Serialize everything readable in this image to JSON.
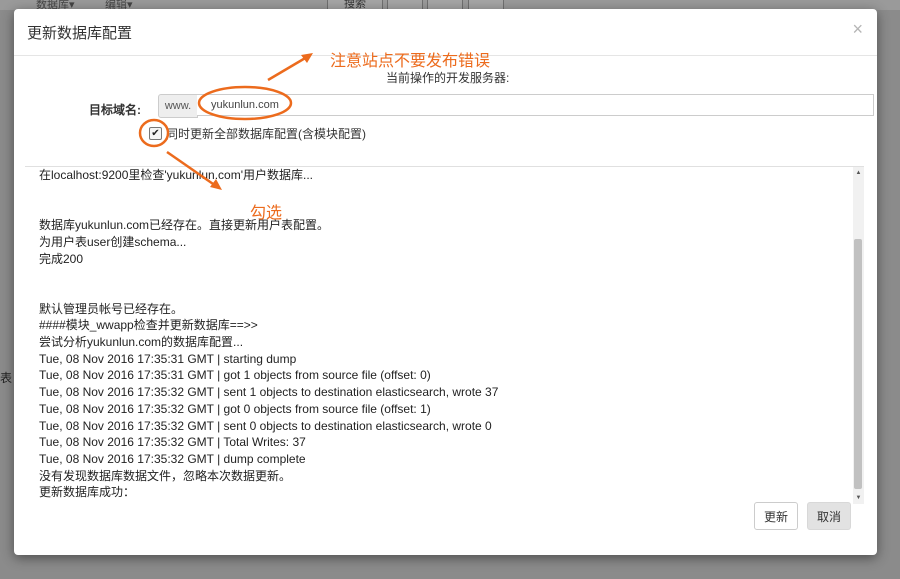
{
  "background": {
    "menu_items": [
      "数据库▾",
      "编辑▾"
    ],
    "search_button": "搜索",
    "side_char": "表"
  },
  "modal": {
    "title": "更新数据库配置",
    "close_symbol": "×",
    "server_label": "当前操作的开发服务器:",
    "target_domain_label": "目标域名:",
    "domain_prefix": "www.",
    "domain_value": "yukunlun.com",
    "sync_all_checked": true,
    "sync_all_label": "同时更新全部数据库配置(含模块配置)",
    "log_text": "在localhost:9200里检查'yukunlun.com'用户数据库...\n\n\n数据库yukunlun.com已经存在。直接更新用户表配置。\n为用户表user创建schema...\n完成200\n\n\n默认管理员帐号已经存在。\n####模块_wwapp检查并更新数据库==>>\n尝试分析yukunlun.com的数据库配置...\nTue, 08 Nov 2016 17:35:31 GMT | starting dump\nTue, 08 Nov 2016 17:35:31 GMT | got 1 objects from source file (offset: 0)\nTue, 08 Nov 2016 17:35:32 GMT | sent 1 objects to destination elasticsearch, wrote 37\nTue, 08 Nov 2016 17:35:32 GMT | got 0 objects from source file (offset: 1)\nTue, 08 Nov 2016 17:35:32 GMT | sent 0 objects to destination elasticsearch, wrote 0\nTue, 08 Nov 2016 17:35:32 GMT | Total Writes: 37\nTue, 08 Nov 2016 17:35:32 GMT | dump complete\n没有发现数据库数据文件，忽略本次数据更新。\n更新数据库成功：",
    "buttons": {
      "update": "更新",
      "cancel": "取消"
    }
  },
  "annotations": {
    "note_top": "注意站点不要发布错误",
    "note_check": "勾选",
    "color": "#ec6b1d"
  }
}
